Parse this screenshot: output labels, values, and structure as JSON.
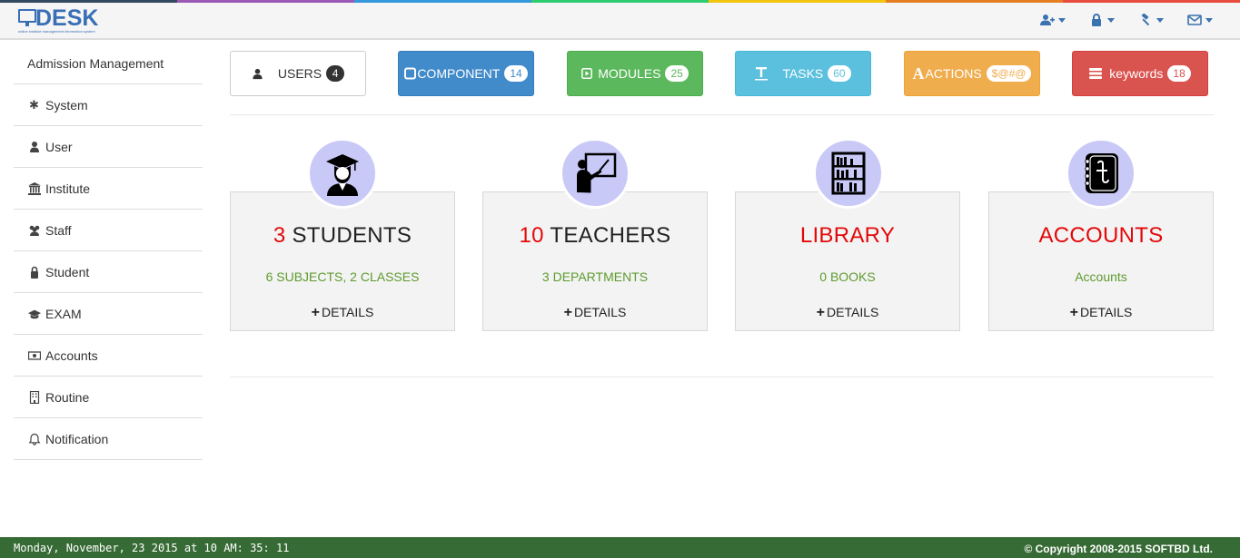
{
  "brand": {
    "name": "DESK",
    "tagline": "online institute management information system"
  },
  "colors": {
    "blue": "#428bca",
    "green": "#5cb85c",
    "cyan": "#5bc0de",
    "orange": "#f0ad4e",
    "red": "#d9534f",
    "footer": "#376b35",
    "accent_red": "#e3090a",
    "sub_green": "#5e9b2e"
  },
  "header_icons": [
    "user-add-icon",
    "lock-icon",
    "gavel-icon",
    "envelope-icon"
  ],
  "sidebar": {
    "items": [
      {
        "label": "Admission Management",
        "icon": ""
      },
      {
        "label": "System",
        "icon": "asterisk-icon"
      },
      {
        "label": "User",
        "icon": "user-icon"
      },
      {
        "label": "Institute",
        "icon": "institution-icon"
      },
      {
        "label": "Staff",
        "icon": "users-icon"
      },
      {
        "label": "Student",
        "icon": "lock-icon"
      },
      {
        "label": "EXAM",
        "icon": "graduation-cap-icon"
      },
      {
        "label": "Accounts",
        "icon": "money-icon"
      },
      {
        "label": "Routine",
        "icon": "building-icon"
      },
      {
        "label": "Notification",
        "icon": "bell-icon"
      }
    ]
  },
  "buttons": [
    {
      "label": "USERS",
      "badge": "4",
      "icon": "user-icon"
    },
    {
      "label": "COMPONENT",
      "badge": "14",
      "icon": "square-icon"
    },
    {
      "label": "MODULES",
      "badge": "25",
      "icon": "play-square-icon"
    },
    {
      "label": "TASKS",
      "badge": "60",
      "icon": "text-icon"
    },
    {
      "label": "ACTIONS",
      "badge": "$@#@",
      "icon": "font-icon"
    },
    {
      "label": "keywords",
      "badge": "18",
      "icon": "tasks-icon"
    }
  ],
  "cards": [
    {
      "number": "3",
      "title": "STUDENTS",
      "subtitle": "6 SUBJECTS, 2 CLASSES",
      "details": "DETAILS",
      "icon": "graduate-icon"
    },
    {
      "number": "10",
      "title": "TEACHERS",
      "subtitle": "3 DEPARTMENTS",
      "details": "DETAILS",
      "icon": "teacher-icon"
    },
    {
      "number": "",
      "title": "LIBRARY",
      "subtitle": "0 BOOKS",
      "details": "DETAILS",
      "icon": "bookshelf-icon"
    },
    {
      "number": "",
      "title": "ACCOUNTS",
      "subtitle": "Accounts",
      "details": "DETAILS",
      "icon": "ledger-icon"
    }
  ],
  "footer": {
    "datetime": "Monday, November, 23 2015 at 10 AM: 35: 11",
    "copyright": "© Copyright 2008-2015 SOFTBD Ltd."
  }
}
